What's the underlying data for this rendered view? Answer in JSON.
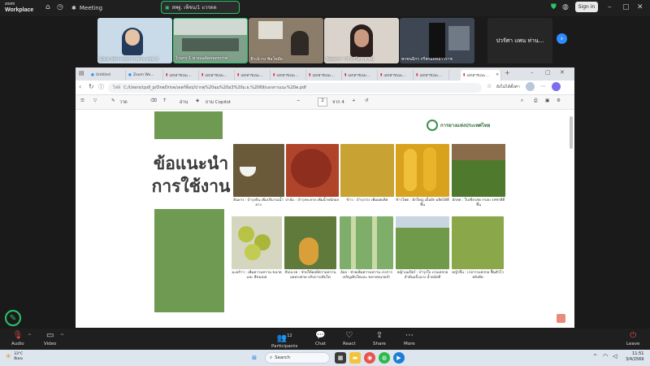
{
  "zoom": {
    "logo_line1": "zoom",
    "logo_line2": "Workplace",
    "meeting_label": "Meeting",
    "sharing_label": "สพฐ. เพ็ชน/1 แวรดด",
    "signin_label": "Sign in",
    "accent_color": "#2d8cff",
    "more_participants_label": "ปวรัศา แพน ห่าน...",
    "participants": [
      {
        "name": "นุ้งมน นิลทวาทยวราจชาน สพพ 3",
        "bg": "#c9dbe9"
      },
      {
        "name": "ไวนกร 1 ทางแลด้ดจนทรภาพ",
        "bg": "#7fa08a"
      },
      {
        "name": "ฟ้าเน้ารง พิษโซอ๊ด",
        "bg": "#8c7d6a"
      },
      {
        "name": "ลัดนนรก าารั ศรีโฮวาส คป",
        "bg": "#d9d3cc"
      },
      {
        "name": "พรชนฉีกร กรีพรมดทฉ่าวราช",
        "bg": "#3d4652"
      }
    ],
    "bottom_items": [
      {
        "label": "Audio",
        "icon": "microphone-muted-icon"
      },
      {
        "label": "Video",
        "icon": "video-camera-icon"
      },
      {
        "label": "Participants",
        "icon": "participants-icon",
        "count": "12"
      },
      {
        "label": "Chat",
        "icon": "chat-icon"
      },
      {
        "label": "React",
        "icon": "heart-icon"
      },
      {
        "label": "Share",
        "icon": "share-icon"
      },
      {
        "label": "More",
        "icon": "more-icon"
      },
      {
        "label": "Leave",
        "icon": "leave-icon"
      }
    ]
  },
  "browser": {
    "tabs": [
      {
        "label": "Untitled"
      },
      {
        "label": "Zoom Wo..."
      },
      {
        "label": "เอกสารแนะ..."
      },
      {
        "label": "เอกสารแนะ..."
      },
      {
        "label": "เอกสารแนะ..."
      },
      {
        "label": "เอกสารแนะ..."
      },
      {
        "label": "เอกสารแนะ..."
      },
      {
        "label": "เอกสารแนะ..."
      },
      {
        "label": "เอกสารแนะ..."
      },
      {
        "label": "เอกสารแนะ..."
      }
    ],
    "active_tab": "เอกสารแนะ...",
    "file_prefix": "ไฟล์",
    "url": "C:/Users/cpdl_p/OneDrive/เดสก์ท็อป/ปากตุ%20ฉม%20ม3%20ม.ย.%2069/เอกสารแนะ%20ต.pdf",
    "reading_mode": "ยังไม่ได้ตั้งค่า",
    "pdf": {
      "draw_label": "วาด",
      "read_aloud": "อ่าน",
      "ask_copilot": "ถาม Copilot",
      "page_current": "2",
      "page_total": "จาก 4"
    }
  },
  "slide": {
    "title_line1": "ข้อแนะนำ",
    "title_line2": "การใช้งาน",
    "logo_text": "การยางแห่งประเทศไทย",
    "accent_green": "#6f9a52",
    "crops": [
      {
        "caption": "ต้นยาง : บำรุงต้น เพิ่มปริมาณน้ำยาง",
        "color": "#6b5a3a"
      },
      {
        "caption": "ปาล์ม : บำรุงทะลาย เพิ่มน้ำหนักผล",
        "color": "#b0442a"
      },
      {
        "caption": "ข้าว : บำรุงรวง เพิ่มผลผลิต",
        "color": "#c8a232"
      },
      {
        "caption": "ข้าวโพด : ฝักใหญ่ เต็มฝัก ผลิตได้ดีขึ้น",
        "color": "#d8a21c"
      },
      {
        "caption": "ผักสด : ใบเขียวสด กรอบ รสชาติดีขึ้น",
        "color": "#4f7a2e"
      },
      {
        "caption": "มะพร้าว : เพิ่มความหวาน ขนาด และ สีของผล",
        "color": "#c2c455"
      },
      {
        "caption": "สับปะรด : ช่วยให้ผลมีความหวาน ผลทรงสวย ปรับการเติบโต",
        "color": "#8a6a2e"
      },
      {
        "caption": "อ้อย : ช่วยเพิ่มความหวาน เร่งการเจริญเติบโตและ ขยายขนาดลำ",
        "color": "#7fae6a"
      },
      {
        "caption": "หญ้าเนเปียร์ : บำรุงใบ เร่งแตกกอ ลำต้นแข็งแรง น้ำหนักดี",
        "color": "#6e9a4a"
      },
      {
        "caption": "หญ้าอื่น : เร่งการแตกกอ ฟื้นตัวไวหลังตัด",
        "color": "#8aa84a"
      }
    ]
  },
  "taskbar": {
    "weather_temp": "33°C",
    "weather_desc": "มีเมฆ",
    "search_label": "Search",
    "time": "11:51",
    "date": "3/4/2569"
  }
}
